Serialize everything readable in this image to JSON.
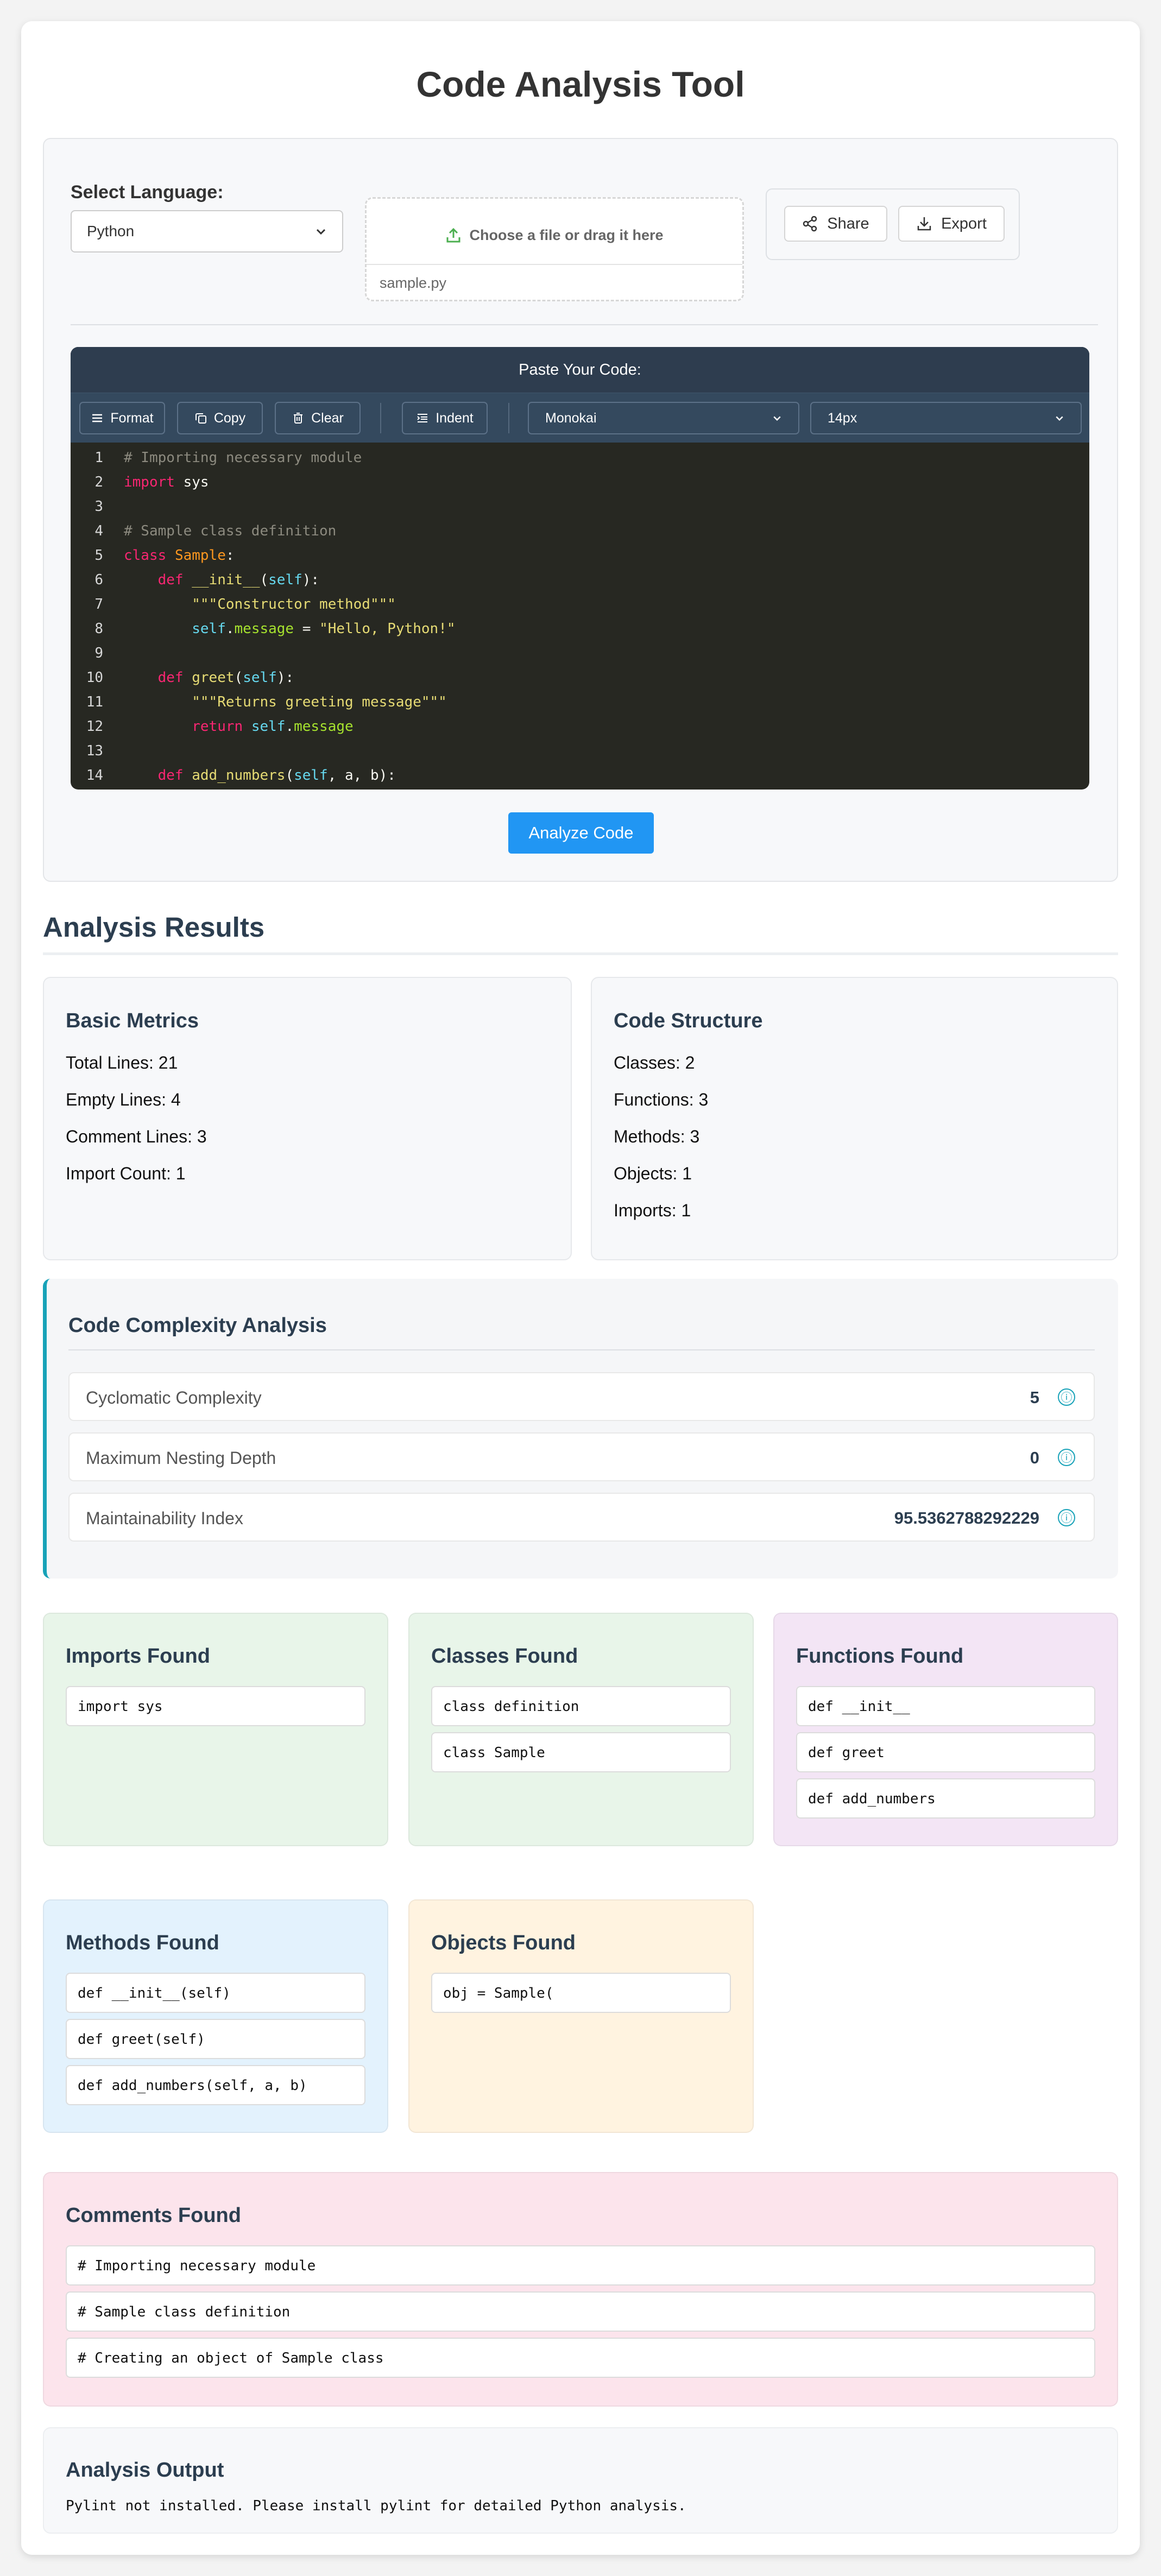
{
  "app": {
    "title": "Code Analysis Tool"
  },
  "input": {
    "language_label": "Select Language:",
    "language_value": "Python",
    "file_prompt": "Choose a file or drag it here",
    "file_name": "sample.py",
    "share_label": "Share",
    "export_label": "Export"
  },
  "editor": {
    "header": "Paste Your Code:",
    "toolbar": {
      "format": "Format",
      "copy": "Copy",
      "clear": "Clear",
      "indent": "Indent",
      "theme": "Monokai",
      "font_size": "14px"
    },
    "line_numbers": [
      "1",
      "2",
      "3",
      "4",
      "5",
      "6",
      "7",
      "8",
      "9",
      "10",
      "11",
      "12",
      "13",
      "14"
    ]
  },
  "analyze_button": "Analyze Code",
  "results": {
    "title": "Analysis Results",
    "basic": {
      "title": "Basic Metrics",
      "total_lines": "Total Lines: 21",
      "empty_lines": "Empty Lines: 4",
      "comment_lines": "Comment Lines: 3",
      "import_count": "Import Count: 1"
    },
    "structure": {
      "title": "Code Structure",
      "classes": "Classes: 2",
      "functions": "Functions: 3",
      "methods": "Methods: 3",
      "objects": "Objects: 1",
      "imports": "Imports: 1"
    },
    "complexity": {
      "title": "Code Complexity Analysis",
      "rows": [
        {
          "label": "Cyclomatic Complexity",
          "value": "5"
        },
        {
          "label": "Maximum Nesting Depth",
          "value": "0"
        },
        {
          "label": "Maintainability Index",
          "value": "95.5362788292229"
        }
      ],
      "info_glyph": "ⓘ"
    },
    "imports_found": {
      "title": "Imports Found",
      "items": [
        "import sys"
      ],
      "bg": "#e8f5e9"
    },
    "classes_found": {
      "title": "Classes Found",
      "items": [
        "class definition",
        "class Sample"
      ],
      "bg": "#e8f5e9"
    },
    "functions_found": {
      "title": "Functions Found",
      "items": [
        "def __init__",
        "def greet",
        "def add_numbers"
      ],
      "bg": "#f3e5f5"
    },
    "methods_found": {
      "title": "Methods Found",
      "items": [
        "def __init__(self)",
        "def greet(self)",
        "def add_numbers(self, a, b)"
      ],
      "bg": "#e3f2fd"
    },
    "objects_found": {
      "title": "Objects Found",
      "items": [
        "obj = Sample("
      ],
      "bg": "#fff3e0"
    },
    "comments_found": {
      "title": "Comments Found",
      "items": [
        "# Importing necessary module",
        "# Sample class definition",
        "# Creating an object of Sample class"
      ],
      "bg": "#fce4ec"
    },
    "output": {
      "title": "Analysis Output",
      "text": "Pylint not installed. Please install pylint for detailed Python analysis."
    }
  },
  "colors": {
    "accent": "#2196f3",
    "editor_bg": "#272822",
    "editor_header": "#2e3d4f",
    "toolbar": "#34495e",
    "complexity_border": "#17a2b8"
  }
}
